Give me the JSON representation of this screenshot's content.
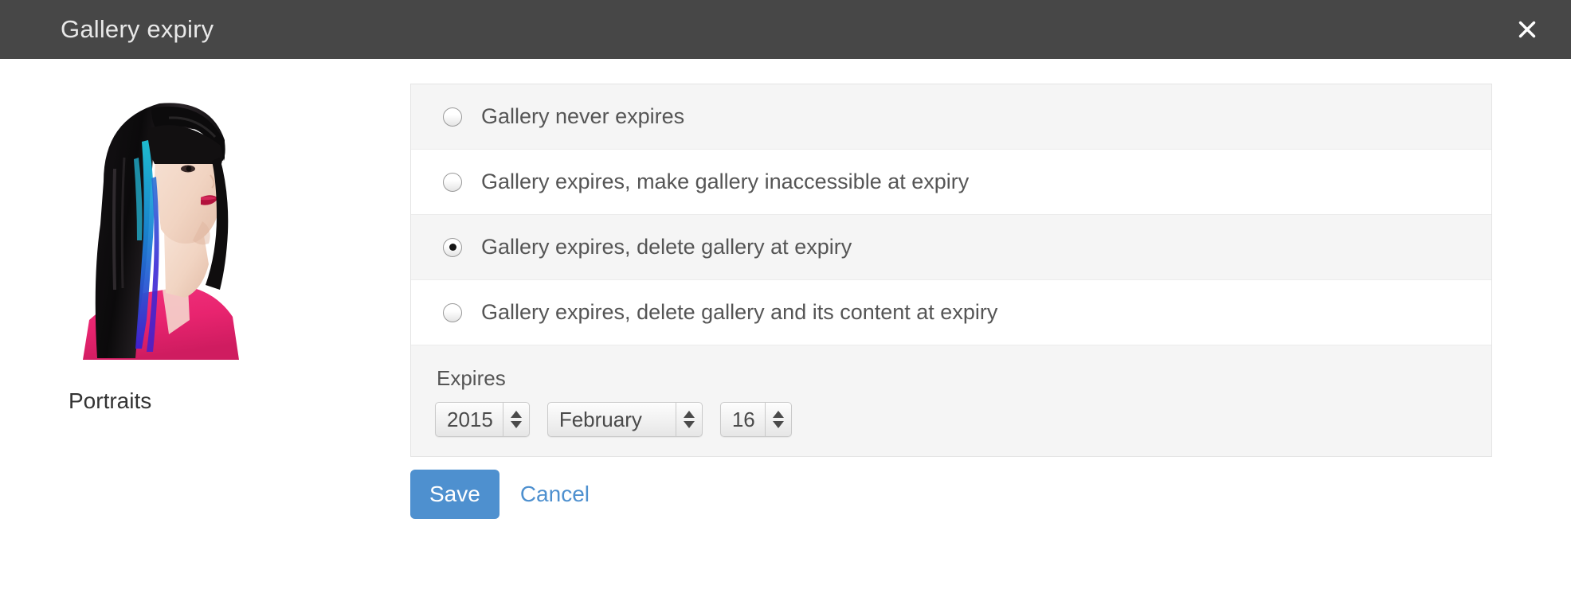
{
  "dialog": {
    "title": "Gallery expiry",
    "close_icon": "close-icon"
  },
  "preview": {
    "gallery_name": "Portraits",
    "thumbnail_alt": "portrait-photo-woman-black-hair-blue-purple-streaks-pink-top"
  },
  "options": {
    "selected_index": 2,
    "items": [
      {
        "label": "Gallery never expires",
        "checked": false
      },
      {
        "label": "Gallery expires, make gallery inaccessible at expiry",
        "checked": false
      },
      {
        "label": "Gallery expires, delete gallery at expiry",
        "checked": true
      },
      {
        "label": "Gallery expires, delete gallery and its content at expiry",
        "checked": false
      }
    ]
  },
  "expires": {
    "label": "Expires",
    "year": "2015",
    "month": "February",
    "day": "16"
  },
  "actions": {
    "save_label": "Save",
    "cancel_label": "Cancel"
  },
  "colors": {
    "titlebar_bg": "#474747",
    "accent_blue": "#4e90cf",
    "row_alt_bg": "#f5f5f5",
    "text_primary": "#555555"
  }
}
